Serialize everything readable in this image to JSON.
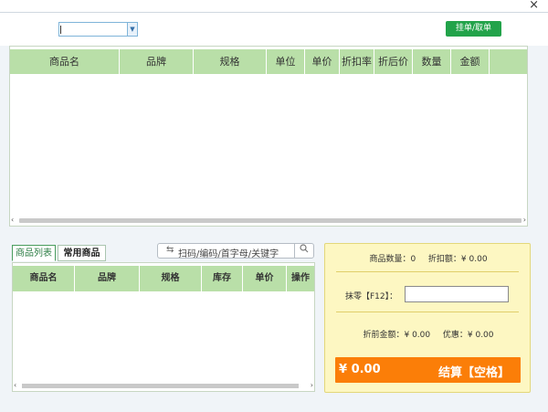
{
  "window": {
    "close_glyph": "×"
  },
  "toolbar": {
    "dropdown_value": "",
    "hang_button": "挂单/取单"
  },
  "cart_table": {
    "columns": [
      "商品名",
      "品牌",
      "规格",
      "单位",
      "单价",
      "折扣率",
      "折后价",
      "数量",
      "金额",
      ""
    ]
  },
  "tabs": [
    {
      "label": "商品列表",
      "active": true
    },
    {
      "label": "常用商品",
      "active": false
    }
  ],
  "search": {
    "placeholder": "扫码/编码/首字母/关键字",
    "scan_glyph": "⇆"
  },
  "product_table": {
    "columns": [
      "商品名",
      "品牌",
      "规格",
      "库存",
      "单价",
      "操作"
    ]
  },
  "summary": {
    "count_label": "商品数量：0",
    "discount_label": "折扣额：¥ 0.00",
    "zero_label": "抹零【F12】：",
    "zero_value": "",
    "pre_discount_label": "折前金额：¥ 0.00",
    "promo_label": "优惠：¥ 0.00"
  },
  "checkout": {
    "amount": "¥ 0.00",
    "label": "结算【空格】"
  },
  "colors": {
    "accent_green": "#22a34a",
    "header_green": "#b9dfa8",
    "checkout_orange": "#fb7e08",
    "panel_yellow": "#fdf7c2"
  }
}
